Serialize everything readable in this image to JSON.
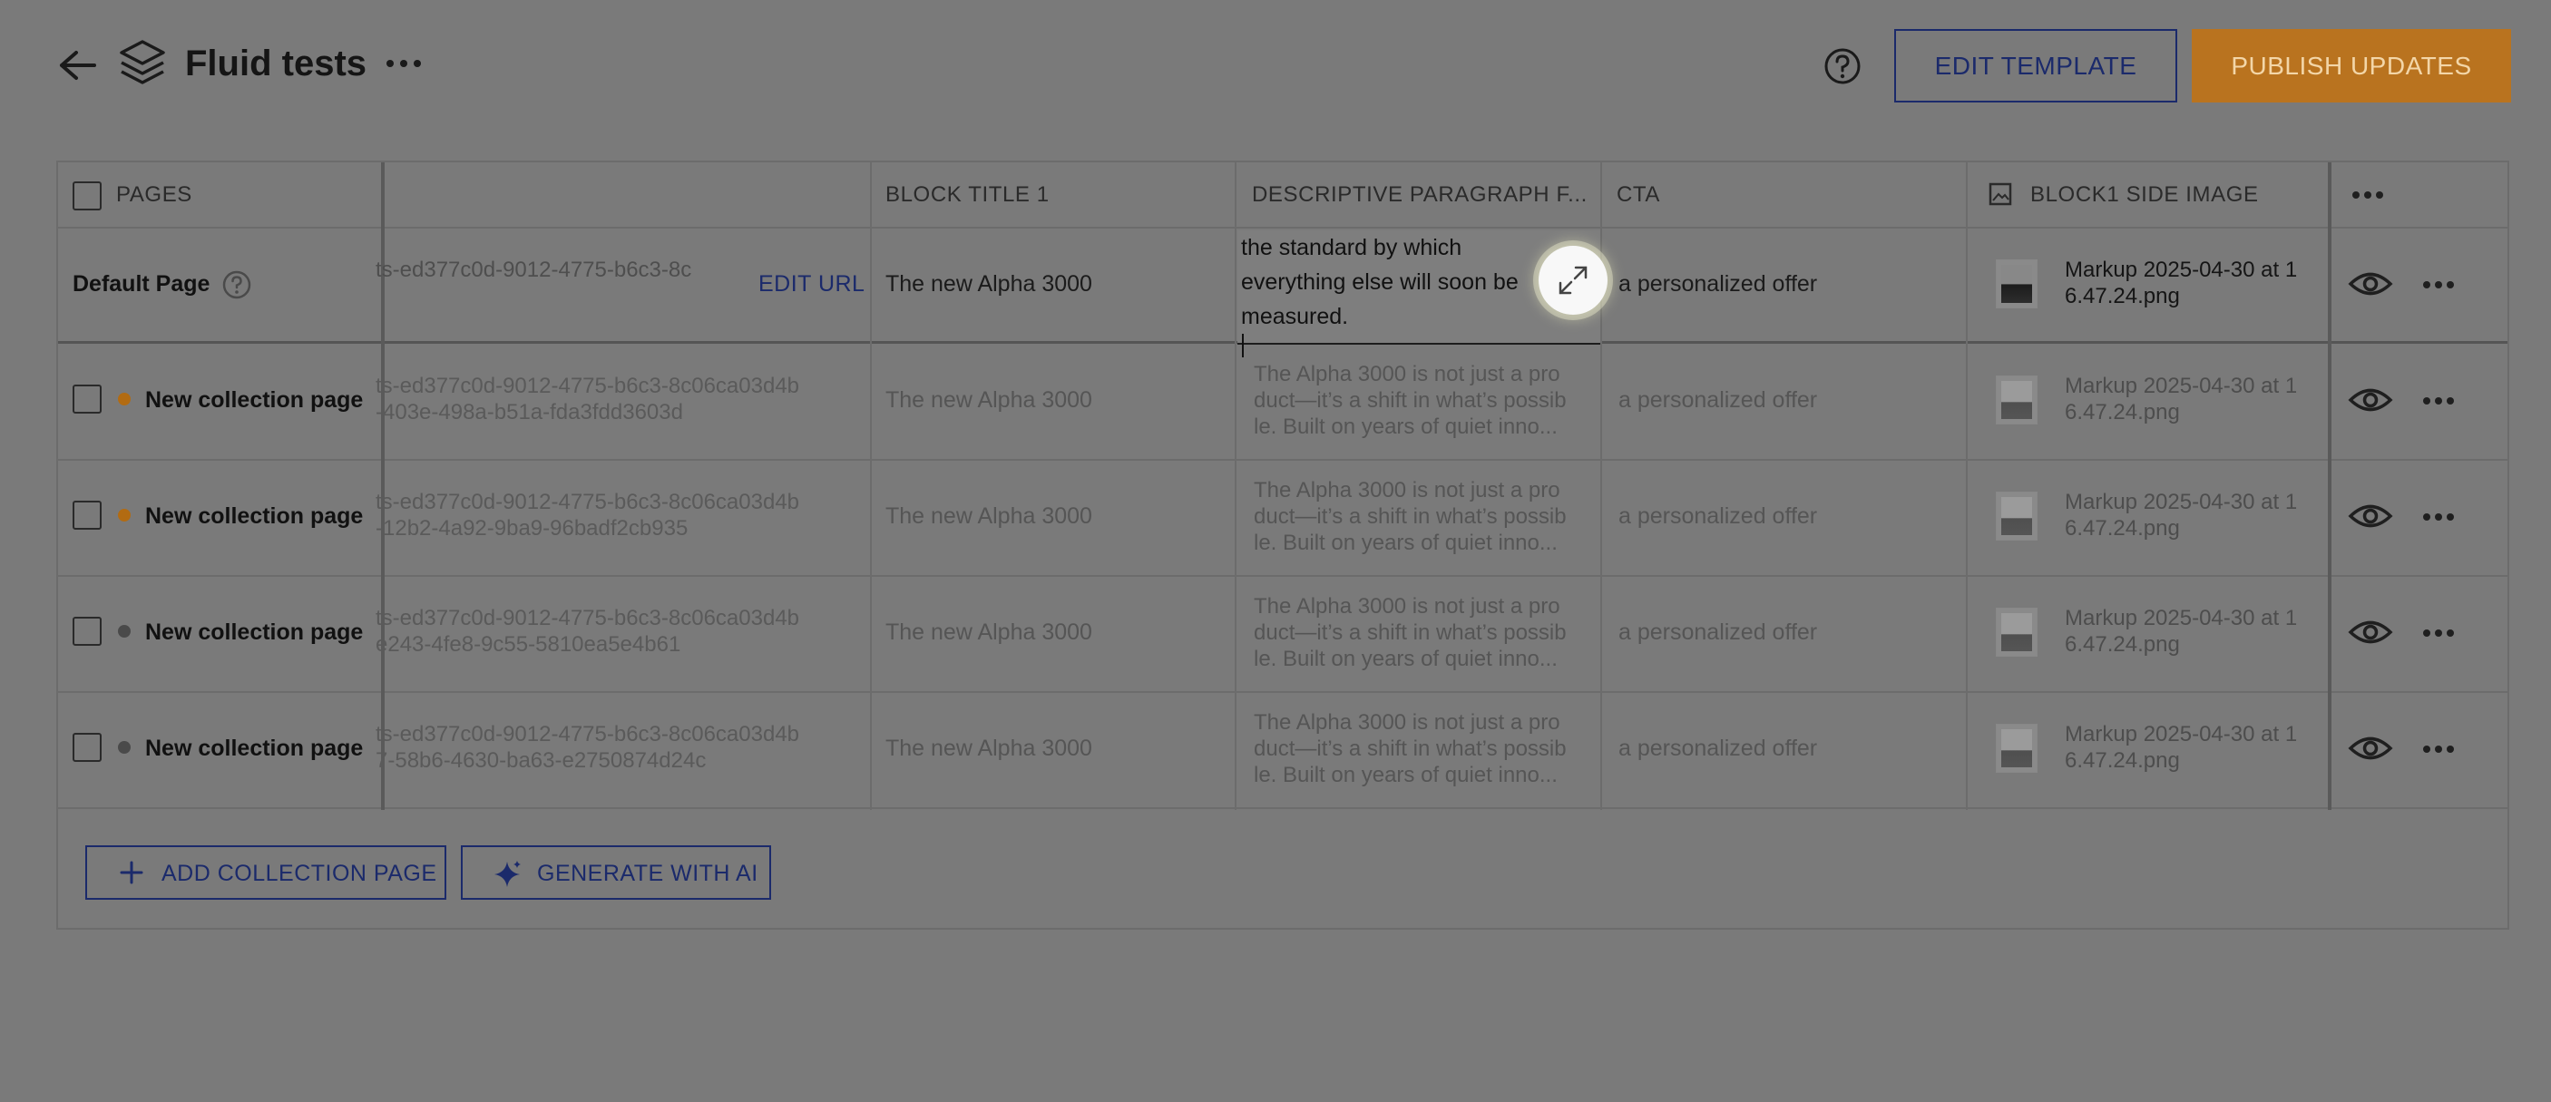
{
  "header": {
    "title": "Fluid tests",
    "edit_template_label": "EDIT TEMPLATE",
    "publish_label": "PUBLISH UPDATES"
  },
  "table": {
    "columns": {
      "pages": "PAGES",
      "slug": "",
      "block_title": "BLOCK TITLE 1",
      "paragraph": "DESCRIPTIVE PARAGRAPH F...",
      "cta": "CTA",
      "side_image": "BLOCK1 SIDE IMAGE"
    },
    "default_row": {
      "name": "Default Page",
      "slug": "ts-ed377c0d-9012-4775-b6c3-8c",
      "edit_url_label": "EDIT URL",
      "block_title": "The new Alpha 3000",
      "paragraph_lines": [
        "the standard by which",
        "everything else will soon be",
        "measured."
      ],
      "cta": "a personalized offer",
      "image_line1": "Markup 2025-04-30 at 1",
      "image_line2": "6.47.24.png"
    },
    "rows": [
      {
        "name": "New collection page",
        "status_color": "#b26b12",
        "slug_line1": "ts-ed377c0d-9012-4775-b6c3-8c06ca03d4b",
        "slug_line2": "-403e-498a-b51a-fda3fdd3603d",
        "block_title": "The new Alpha 3000",
        "para1": "The Alpha 3000 is not just a pro",
        "para2": "duct—it’s a shift in what’s possib",
        "para3": "le. Built on years of quiet inno...",
        "cta": "a personalized offer",
        "image_line1": "Markup 2025-04-30 at 1",
        "image_line2": "6.47.24.png"
      },
      {
        "name": "New collection page",
        "status_color": "#b26b12",
        "slug_line1": "ts-ed377c0d-9012-4775-b6c3-8c06ca03d4b",
        "slug_line2": "-12b2-4a92-9ba9-96badf2cb935",
        "block_title": "The new Alpha 3000",
        "para1": "The Alpha 3000 is not just a pro",
        "para2": "duct—it’s a shift in what’s possib",
        "para3": "le. Built on years of quiet inno...",
        "cta": "a personalized offer",
        "image_line1": "Markup 2025-04-30 at 1",
        "image_line2": "6.47.24.png"
      },
      {
        "name": "New collection page",
        "status_color": "#4a4a4a",
        "slug_line1": "ts-ed377c0d-9012-4775-b6c3-8c06ca03d4b",
        "slug_line2": "e243-4fe8-9c55-5810ea5e4b61",
        "block_title": "The new Alpha 3000",
        "para1": "The Alpha 3000 is not just a pro",
        "para2": "duct—it’s a shift in what’s possib",
        "para3": "le. Built on years of quiet inno...",
        "cta": "a personalized offer",
        "image_line1": "Markup 2025-04-30 at 1",
        "image_line2": "6.47.24.png"
      },
      {
        "name": "New collection page",
        "status_color": "#4a4a4a",
        "slug_line1": "ts-ed377c0d-9012-4775-b6c3-8c06ca03d4b",
        "slug_line2": "7-58b6-4630-ba63-e2750874d24c",
        "block_title": "The new Alpha 3000",
        "para1": "The Alpha 3000 is not just a pro",
        "para2": "duct—it’s a shift in what’s possib",
        "para3": "le. Built on years of quiet inno...",
        "cta": "a personalized offer",
        "image_line1": "Markup 2025-04-30 at 1",
        "image_line2": "6.47.24.png"
      }
    ]
  },
  "footer": {
    "add_label": "ADD COLLECTION PAGE",
    "ai_label": "GENERATE WITH AI"
  },
  "icons": {
    "back": "arrow-left-icon",
    "layers": "layers-icon",
    "more": "more-horizontal-icon",
    "help": "help-circle-icon",
    "image": "image-icon",
    "eye": "eye-icon",
    "expand": "expand-icon",
    "plus": "plus-icon",
    "sparkle": "sparkle-icon"
  },
  "colors": {
    "overlay_background": "#7a7a7a",
    "brand_navy": "#1b2a6b",
    "publish_button": "#b9731f",
    "status_orange": "#b26b12",
    "status_gray": "#4a4a4a"
  }
}
